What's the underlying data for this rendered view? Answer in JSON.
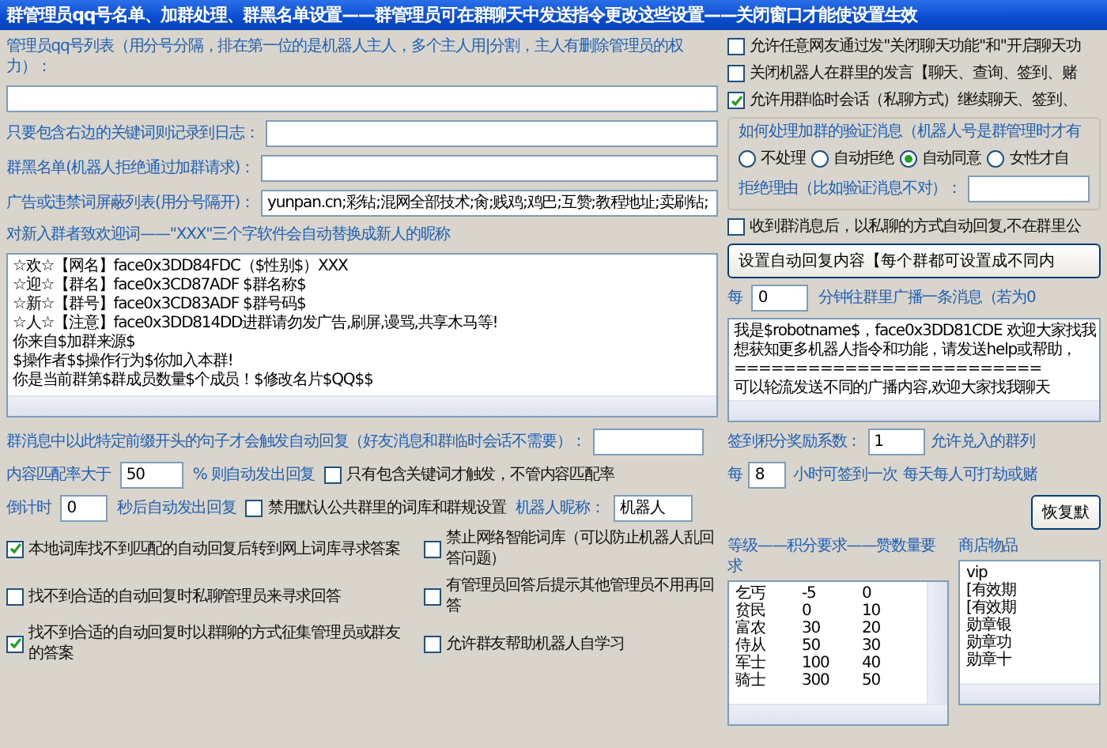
{
  "window": {
    "title": "群管理员qq号名单、加群处理、群黑名单设置——群管理员可在群聊天中发送指令更改这些设置——关闭窗口才能使设置生效"
  },
  "admin_list": {
    "label": "管理员qq号列表（用分号分隔，排在第一位的是机器人主人，多个主人用|分割，主人有删除管理员的权力）："
  },
  "fields": [
    {
      "label": "只要包含右边的关键词则记录到日志："
    },
    {
      "label": "群黑名单(机器人拒绝通过加群请求)："
    },
    {
      "label": "广告或违禁词屏蔽列表(用分号隔开)：",
      "value": "yunpan.cn;彩钻;混网全部技术;肏;贱鸡;鸡巴;互赞;教程地址;卖刷钻;"
    }
  ],
  "welcome": {
    "label": "对新入群者致欢迎词——\"XXX\"三个字软件会自动替换成新人的昵称",
    "lines": [
      "☆欢☆【网名】face0x3DD84FDC（$性别$）XXX",
      "☆迎☆【群名】face0x3CD87ADF $群名称$",
      "☆新☆【群号】face0x3CD83ADF $群号码$",
      "☆人☆【注意】face0x3DD814DD进群请勿发广告,刷屏,谩骂,共享木马等!",
      "你来自$加群来源$",
      "$操作者$$操作行为$你加入本群!",
      "你是当前群第$群成员数量$个成员！$修改名片$QQ$$"
    ]
  },
  "right_options": [
    {
      "label": "允许任意网友通过发\"关闭聊天功能\"和\"开启聊天功",
      "checked": false
    },
    {
      "label": "关闭机器人在群里的发言【聊天、查询、签到、赌",
      "checked": false
    },
    {
      "label": "允许用群临时会话（私聊方式）继续聊天、签到、",
      "checked": true
    }
  ],
  "verify": {
    "title": "如何处理加群的验证消息（机器人号是群管理时才有",
    "options": [
      {
        "label": "不处理",
        "selected": false
      },
      {
        "label": "自动拒绝",
        "selected": false
      },
      {
        "label": "自动同意",
        "selected": true
      },
      {
        "label": "女性才自",
        "selected": false
      }
    ],
    "reason_label": "拒绝理由（比如验证消息不对）："
  },
  "private_reply": {
    "label": "收到群消息后，以私聊的方式自动回复,不在群里公",
    "checked": false
  },
  "reply_button": "设置自动回复内容【每个群都可设置成不同内",
  "broadcast": {
    "prefix": "每",
    "value": "0",
    "suffix": "分钟往群里广播一条消息（若为0",
    "lines": [
      "我是$robotname$，face0x3DD81CDE 欢迎大家找我",
      "想获知更多机器人指令和功能，请发送help或帮助，",
      "=========================",
      "可以轮流发送不同的广播内容,欢迎大家找我聊天"
    ]
  },
  "prefix": {
    "label": "群消息中以此特定前缀开头的句子才会触发自动回复（好友消息和群临时会话不需要）："
  },
  "match_row": {
    "label": "内容匹配率大于",
    "value": "50",
    "suffix": "% 则自动发出回复",
    "checkbox": {
      "label": "只有包含关键词才触发，不管内容匹配率",
      "checked": false
    }
  },
  "countdown_row": {
    "label": "倒计时",
    "value": "0",
    "suffix": "秒后自动发出回复",
    "checkbox": {
      "label": "禁用默认公共群里的词库和群规设置",
      "checked": false
    },
    "nickname_label": "机器人昵称：",
    "nickname_value": "机器人"
  },
  "option_rows": [
    {
      "options": [
        {
          "label": "本地词库找不到匹配的自动回复后转到网上词库寻求答案",
          "checked": true
        },
        {
          "label": "禁止网络智能词库（可以防止机器人乱回答问题）",
          "checked": false
        }
      ]
    },
    {
      "options": [
        {
          "label": "找不到合适的自动回复时私聊管理员来寻求回答",
          "checked": false
        },
        {
          "label": "有管理员回答后提示其他管理员不用再回答",
          "checked": false
        }
      ]
    },
    {
      "options": [
        {
          "label": "找不到合适的自动回复时以群聊的方式征集管理员或群友的答案",
          "checked": true
        },
        {
          "label": "允许群友帮助机器人自学习",
          "checked": false
        }
      ]
    }
  ],
  "signin": {
    "label": "签到积分奖励系数：",
    "value": "1",
    "extra": "允许兑入的群列"
  },
  "interval": {
    "prefix": "每",
    "value": "8",
    "suffix": "小时可签到一次",
    "extra": "每天每人可打劫或赌"
  },
  "restore_button": "恢复默",
  "levels": {
    "title": "等级——积分要求——赞数量要求",
    "rows": [
      [
        "乞丐",
        "-5",
        "0"
      ],
      [
        "贫民",
        "0",
        "10"
      ],
      [
        "富农",
        "30",
        "20"
      ],
      [
        "侍从",
        "50",
        "30"
      ],
      [
        "军士",
        "100",
        "40"
      ],
      [
        "骑士",
        "300",
        "50"
      ]
    ]
  },
  "shop": {
    "title": "商店物品",
    "items": [
      "vip",
      "[有效期",
      "[有效期",
      "勋章银",
      "勋章功",
      "勋章十"
    ]
  }
}
